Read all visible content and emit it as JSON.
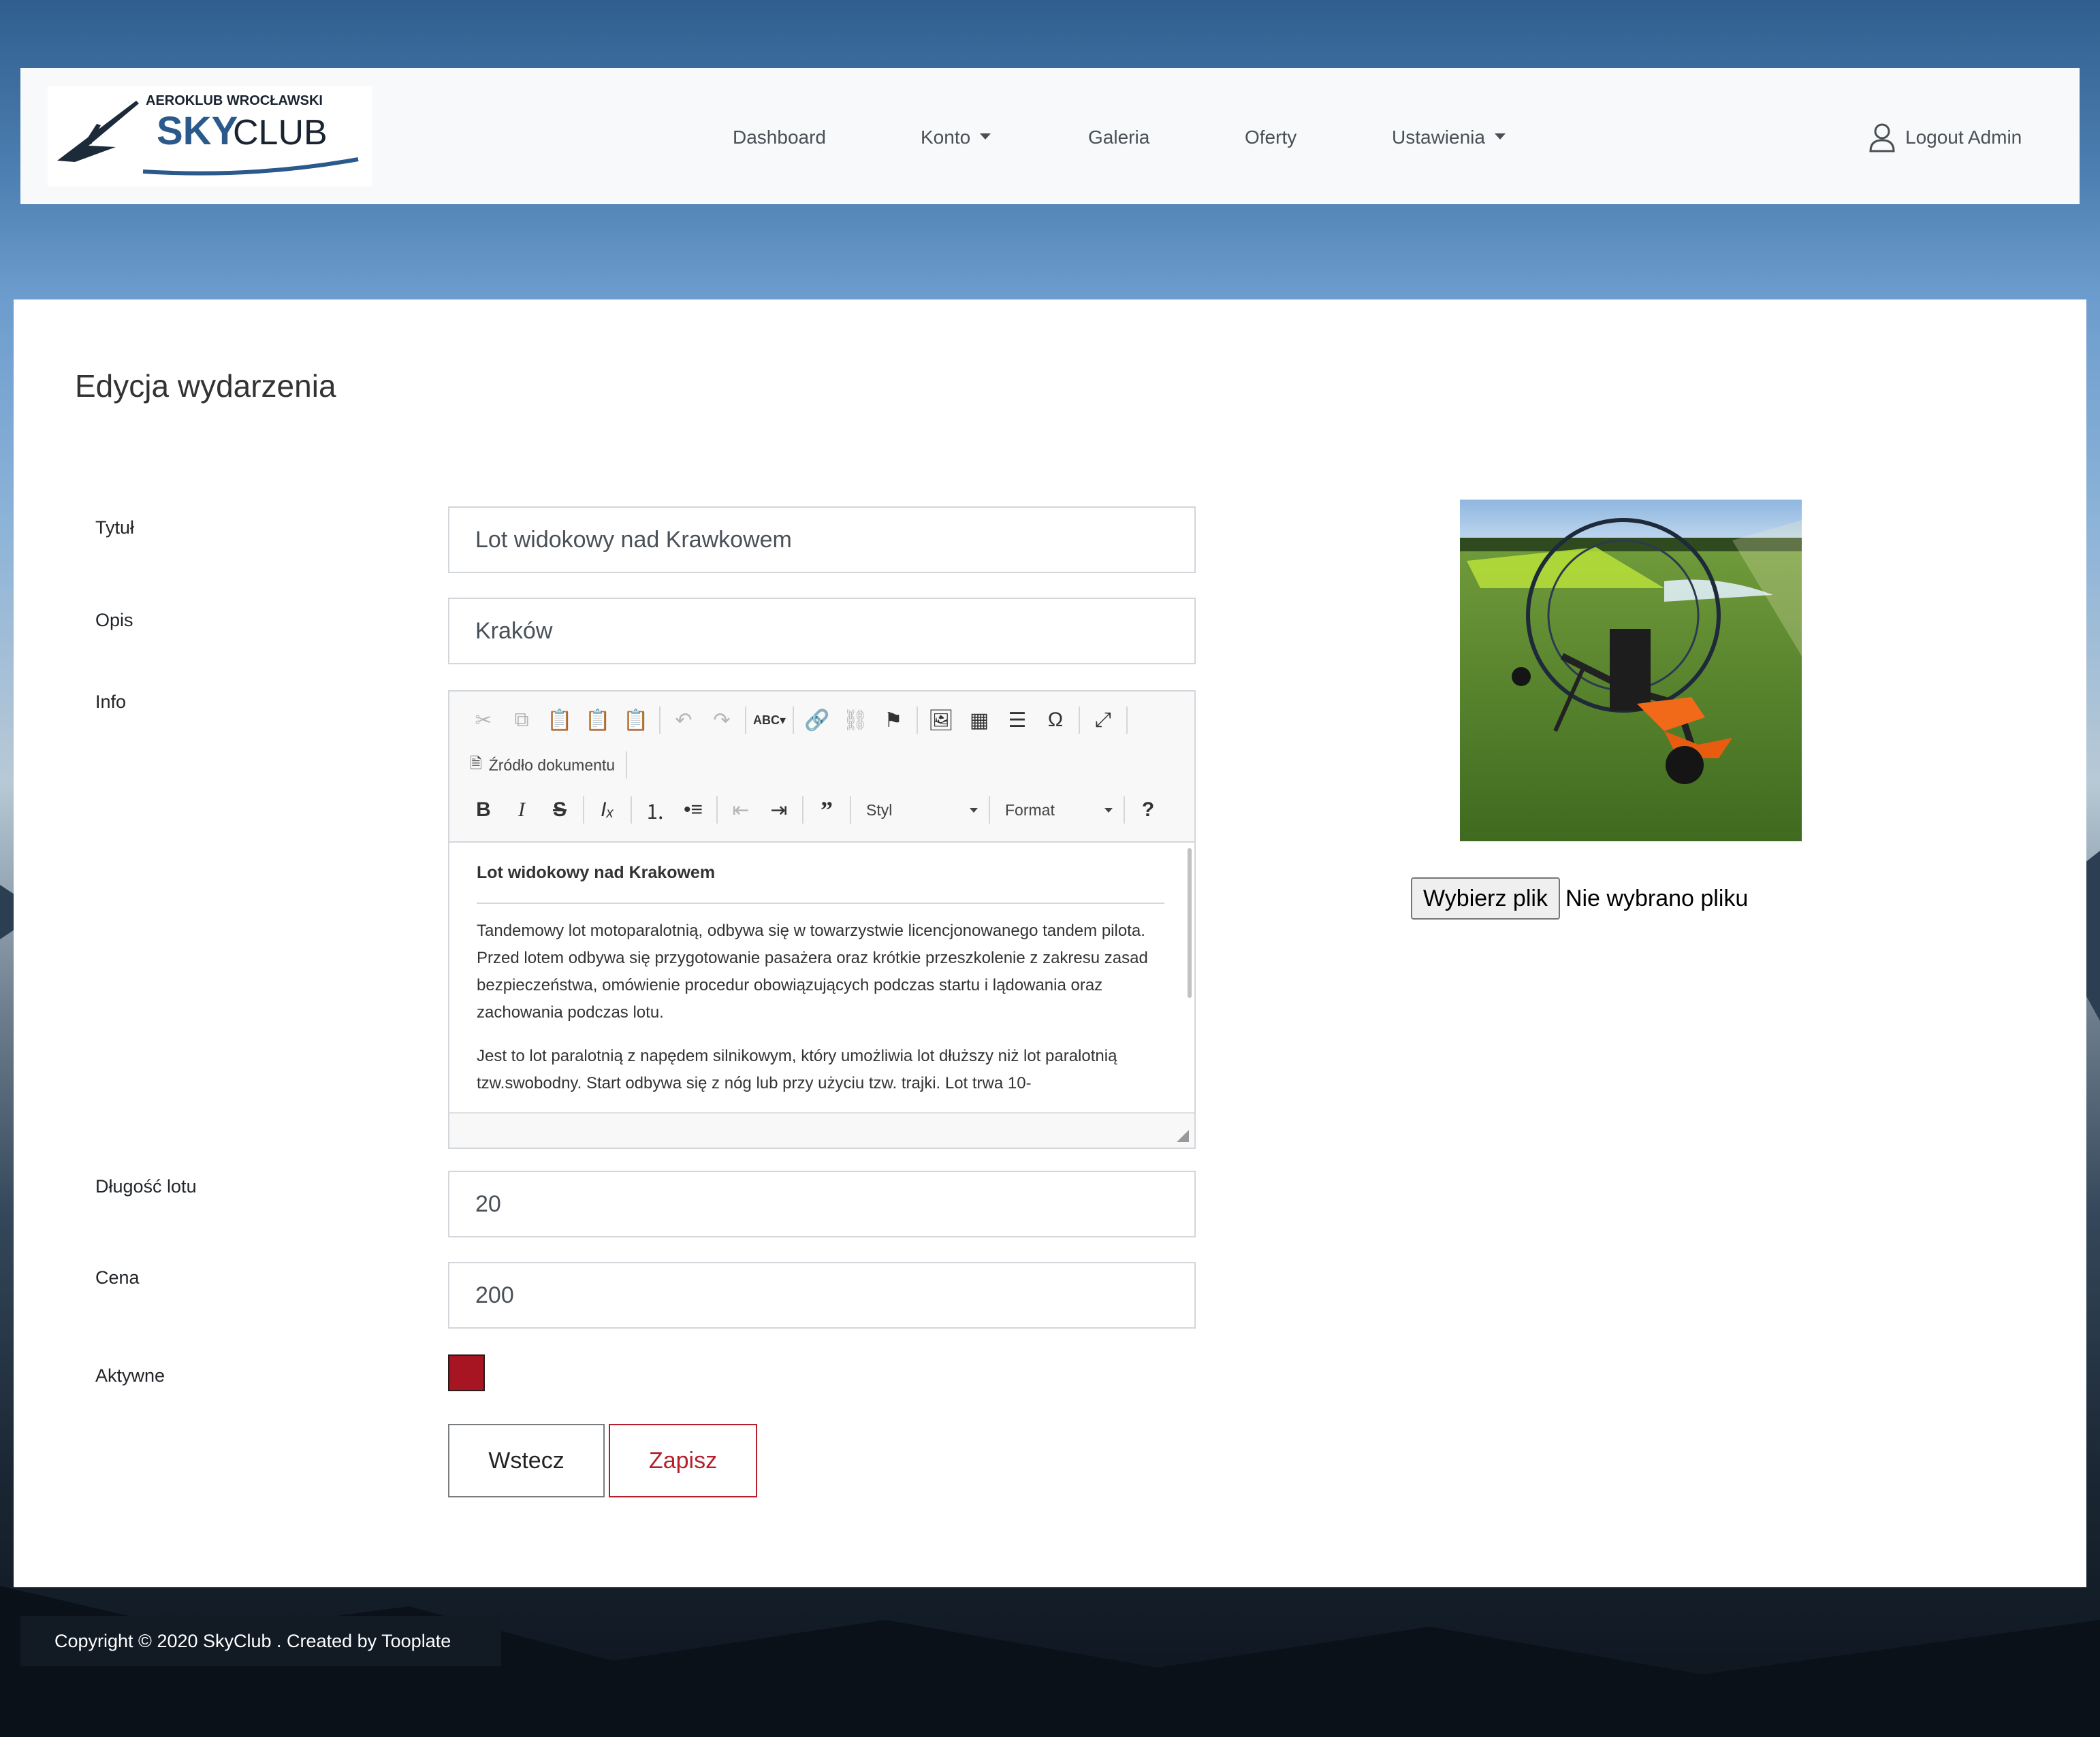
{
  "brand": {
    "top_text": "AEROKLUB WROCŁAWSKI",
    "sky_text": "SKY",
    "club_text": "CLUB"
  },
  "nav": {
    "dashboard": "Dashboard",
    "konto": "Konto",
    "galeria": "Galeria",
    "oferty": "Oferty",
    "ustawienia": "Ustawienia",
    "logout": "Logout Admin"
  },
  "page": {
    "title": "Edycja wydarzenia"
  },
  "form": {
    "tytul_label": "Tytuł",
    "tytul_value": "Lot widokowy nad Krawkowem",
    "opis_label": "Opis",
    "opis_value": "Kraków",
    "info_label": "Info",
    "dlugosc_label": "Długość lotu",
    "dlugosc_value": "20",
    "cena_label": "Cena",
    "cena_value": "200",
    "aktywne_label": "Aktywne",
    "aktywne_checked": true,
    "back_label": "Wstecz",
    "save_label": "Zapisz"
  },
  "editor": {
    "source_label": "Źródło dokumentu",
    "style_combo": "Styl",
    "format_combo": "Format",
    "heading": "Lot widokowy nad Krakowem",
    "paragraph1": "Tandemowy lot motoparalotnią, odbywa się w towarzystwie licencjonowanego tandem pilota. Przed lotem odbywa się przygotowanie pasażera oraz krótkie przeszkolenie z zakresu zasad bezpieczeństwa, omówienie procedur obowiązujących podczas startu i lądowania oraz zachowania podczas lotu.",
    "paragraph2": "Jest to lot paralotnią z napędem silnikowym, który umożliwia lot dłuższy niż lot paralotnią tzw.swobodny. Start odbywa się z nóg lub przy użyciu tzw. trajki. Lot trwa 10-"
  },
  "upload": {
    "button_label": "Wybierz plik",
    "status_text": "Nie wybrano pliku"
  },
  "footer": {
    "copyright": "Copyright © 2020 SkyClub . Created by Tooplate"
  },
  "colors": {
    "accent_red": "#b51f2c",
    "checkbox_fill": "#a81522",
    "navbar_bg": "#f8f9fa",
    "text_dark": "#212529"
  }
}
